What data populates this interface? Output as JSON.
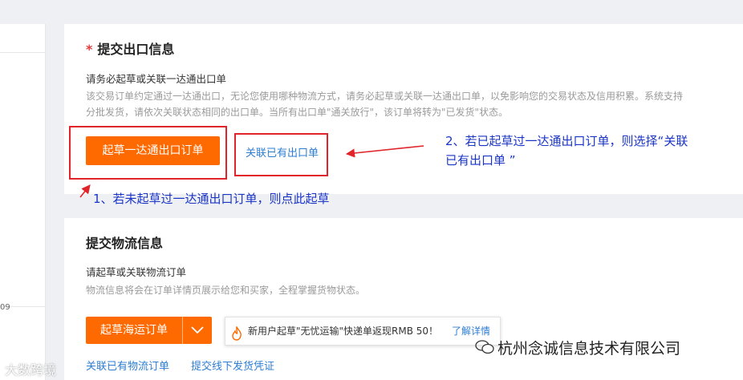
{
  "left_panel": {
    "small_text": "09"
  },
  "export_section": {
    "required_mark": "*",
    "title": "提交出口信息",
    "subtitle": "请务必起草或关联一达通出口单",
    "desc_line1": "该交易订单约定通过一达通出口，无论您使用哪种物流方式，请务必起草或关联一达通出口单，以免影响您的交易状态及信用积累。系统支持",
    "desc_line2": "分批发货，请依次关联状态相同的出口单。当所有出口单\"通关放行\"，该订单将转为\"已发货\"状态。",
    "draft_button": "起草一达通出口订单",
    "link_button": "关联已有出口单"
  },
  "annotations": {
    "note1": "1、若未起草过一达通出口订单，则点此起草",
    "note2_line1": "2、若已起草过一达通出口订单，则选择“关联",
    "note2_line2": "已有出口单 ”"
  },
  "logistics_section": {
    "title": "提交物流信息",
    "subtitle": "请起草或关联物流订单",
    "desc": "物流信息将会在订单详情页展示给您和买家，全程掌握货物状态。",
    "draft_button": "起草海运订单",
    "promo_text": "新用户起草\"无忧运输\"快递单返现RMB 50！",
    "promo_link": "了解详情",
    "link_existing": "关联已有物流订单",
    "offline_link": "提交线下发货凭证"
  },
  "watermark": {
    "text": "杭州念诚信息技术有限公司",
    "left_text": "大数跨境"
  },
  "colors": {
    "accent": "#ff6a00",
    "link": "#2d7dd2",
    "annotation_red": "#e0242a",
    "annotation_blue": "#1a35c6"
  },
  "icons": {
    "dropdown": "chevron-down-icon",
    "promo": "flame-icon",
    "watermark": "wechat-icon"
  }
}
